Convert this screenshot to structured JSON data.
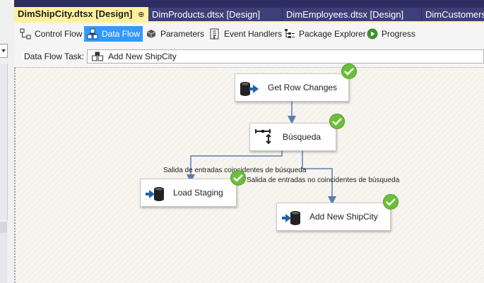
{
  "tabs": [
    {
      "label": "DimShipCity.dtsx [Design]",
      "active": true
    },
    {
      "label": "DimProducts.dtsx [Design]",
      "active": false
    },
    {
      "label": "DimEmployees.dtsx [Design]",
      "active": false
    },
    {
      "label": "DimCustomers",
      "active": false
    }
  ],
  "tab_pin": "⊕",
  "tab_close": "×",
  "toolbar": {
    "control_flow": "Control Flow",
    "data_flow": "Data Flow",
    "parameters": "Parameters",
    "event_handlers": "Event Handlers",
    "package_explorer": "Package Explorer",
    "progress": "Progress"
  },
  "task": {
    "label": "Data Flow Task:",
    "value": "Add New ShipCity"
  },
  "components": {
    "get_row_changes": "Get Row Changes",
    "busqueda": "Búsqueda",
    "load_staging": "Load Staging",
    "add_new_shipcity": "Add New ShipCity"
  },
  "paths": {
    "match": "Salida de entradas coincidentes de búsqueda",
    "no_match": "Salida de entradas no coincidentes de búsqueda"
  },
  "colors": {
    "tab_bg": "#2d2d62",
    "active_tab": "#fff29d",
    "active_toolbar": "#3399ff",
    "success": "#6cbf3a",
    "connector": "#5a7fb0"
  }
}
